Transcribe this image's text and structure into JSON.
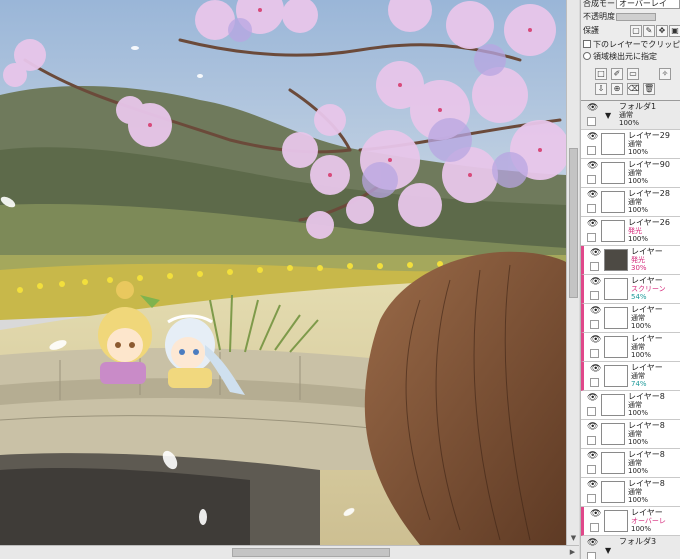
{
  "panel": {
    "blend_mode_label": "合成モード",
    "blend_mode_value": "オーバーレイ",
    "opacity_label": "不透明度",
    "protect_label": "保護",
    "clip_label": "下のレイヤーでクリッピング",
    "selection_source_label": "領域検出元に指定"
  },
  "layers": [
    {
      "name": "フォルダ1",
      "mode": "通常",
      "opacity": "100%",
      "folder": true
    },
    {
      "name": "レイヤー29",
      "mode": "通常",
      "opacity": "100%"
    },
    {
      "name": "レイヤー90",
      "mode": "通常",
      "opacity": "100%"
    },
    {
      "name": "レイヤー28",
      "mode": "通常",
      "opacity": "100%"
    },
    {
      "name": "レイヤー26",
      "mode": "発光",
      "opacity": "100%"
    },
    {
      "name": "レイヤー",
      "mode": "発光",
      "opacity": "30%",
      "clip": true
    },
    {
      "name": "レイヤー",
      "mode": "スクリーン",
      "opacity": "54%",
      "clip": true
    },
    {
      "name": "レイヤー",
      "mode": "通常",
      "opacity": "100%",
      "clip": true
    },
    {
      "name": "レイヤー",
      "mode": "通常",
      "opacity": "100%",
      "clip": true
    },
    {
      "name": "レイヤー",
      "mode": "通常",
      "opacity": "74%",
      "clip": true
    },
    {
      "name": "レイヤー8",
      "mode": "通常",
      "opacity": "100%"
    },
    {
      "name": "レイヤー8",
      "mode": "通常",
      "opacity": "100%"
    },
    {
      "name": "レイヤー8",
      "mode": "通常",
      "opacity": "100%"
    },
    {
      "name": "レイヤー8",
      "mode": "通常",
      "opacity": "100%"
    },
    {
      "name": "レイヤー",
      "mode": "オーバーレ",
      "opacity": "100%",
      "clip": true
    },
    {
      "name": "フォルダ3",
      "mode": "",
      "opacity": "",
      "folder": true
    }
  ]
}
